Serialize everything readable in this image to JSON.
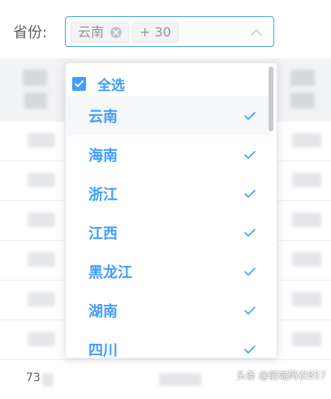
{
  "filter": {
    "label": "省份:",
    "selected_tag": "云南",
    "more_tag": "+ 30"
  },
  "dropdown": {
    "select_all_label": "全选",
    "options": [
      "云南",
      "海南",
      "浙江",
      "江西",
      "黑龙江",
      "湖南",
      "四川"
    ]
  },
  "table": {
    "last_row_number": "73"
  },
  "watermark": "头条 @前端码农857",
  "colors": {
    "accent": "#409eff",
    "tag_bg": "#f4f4f5",
    "text": "#606266"
  }
}
